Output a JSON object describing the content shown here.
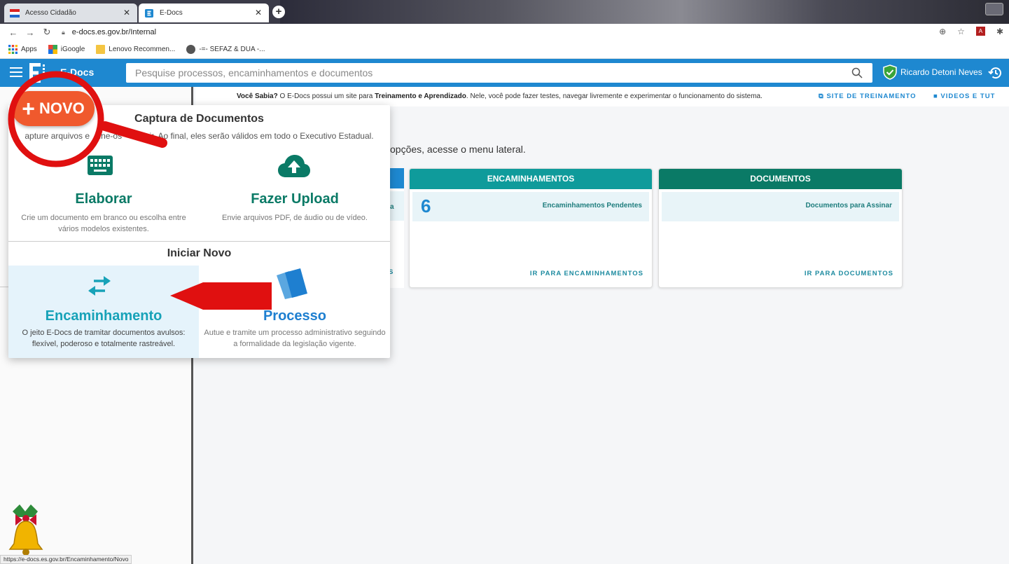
{
  "browser": {
    "tabs": [
      {
        "title": "Acesso Cidadão",
        "active": false
      },
      {
        "title": "E-Docs",
        "active": true
      }
    ],
    "url": "e-docs.es.gov.br/Internal",
    "status_url": "https://e-docs.es.gov.br/Encaminhamento/Novo",
    "bookmarks": [
      {
        "label": "Apps"
      },
      {
        "label": "iGoogle"
      },
      {
        "label": "Lenovo Recommen..."
      },
      {
        "label": "-=- SEFAZ & DUA -..."
      }
    ]
  },
  "header": {
    "app_name": "E-Docs",
    "search_placeholder": "Pesquise processos, encaminhamentos e documentos",
    "user_name": "Ricardo Detoni Neves",
    "brand_color": "#1e88d0"
  },
  "infobar": {
    "lead": "Você Sabia?",
    "text_pre": " O E-Docs possui um site para ",
    "highlight": "Treinamento e Aprendizado",
    "text_post": ". Nele, você pode fazer testes, navegar livremente e experimentar o funcionamento do sistema.",
    "training_link": "SITE DE TREINAMENTO",
    "videos_link": "VIDEOS E TUT"
  },
  "main": {
    "subtitle": "opções, acesse o menu lateral.",
    "partial_card": {
      "label": "a",
      "link": "S"
    },
    "cards": [
      {
        "title": "ENCAMINHAMENTOS",
        "count": "6",
        "label": "Encaminhamentos Pendentes",
        "link": "IR PARA ENCAMINHAMENTOS",
        "color": "#0f9b9b"
      },
      {
        "title": "DOCUMENTOS",
        "count": "",
        "label": "Documentos para Assinar",
        "link": "IR PARA DOCUMENTOS",
        "color": "#0a7a66"
      }
    ]
  },
  "novo_button": {
    "label": "NOVO",
    "color": "#f0592d"
  },
  "menu": {
    "capture_title": "Captura de Documentos",
    "capture_desc_left": "apture arquivos e",
    "capture_desc_mid": "sine-os",
    "capture_desc_right": "ir. Ao final, eles serão válidos em todo o Executivo Estadual.",
    "elaborar": {
      "label": "Elaborar",
      "desc": "Crie um documento em branco ou escolha entre vários modelos existentes."
    },
    "upload": {
      "label": "Fazer Upload",
      "desc": "Envie arquivos PDF, de áudio ou de vídeo."
    },
    "new_title": "Iniciar Novo",
    "encaminhamento": {
      "label": "Encaminhamento",
      "desc": "O jeito E-Docs de tramitar documentos avulsos: flexível, poderoso e totalmente rastreável."
    },
    "processo": {
      "label": "Processo",
      "desc": "Autue e tramite um processo administrativo seguindo a formalidade da legislação vigente."
    }
  }
}
